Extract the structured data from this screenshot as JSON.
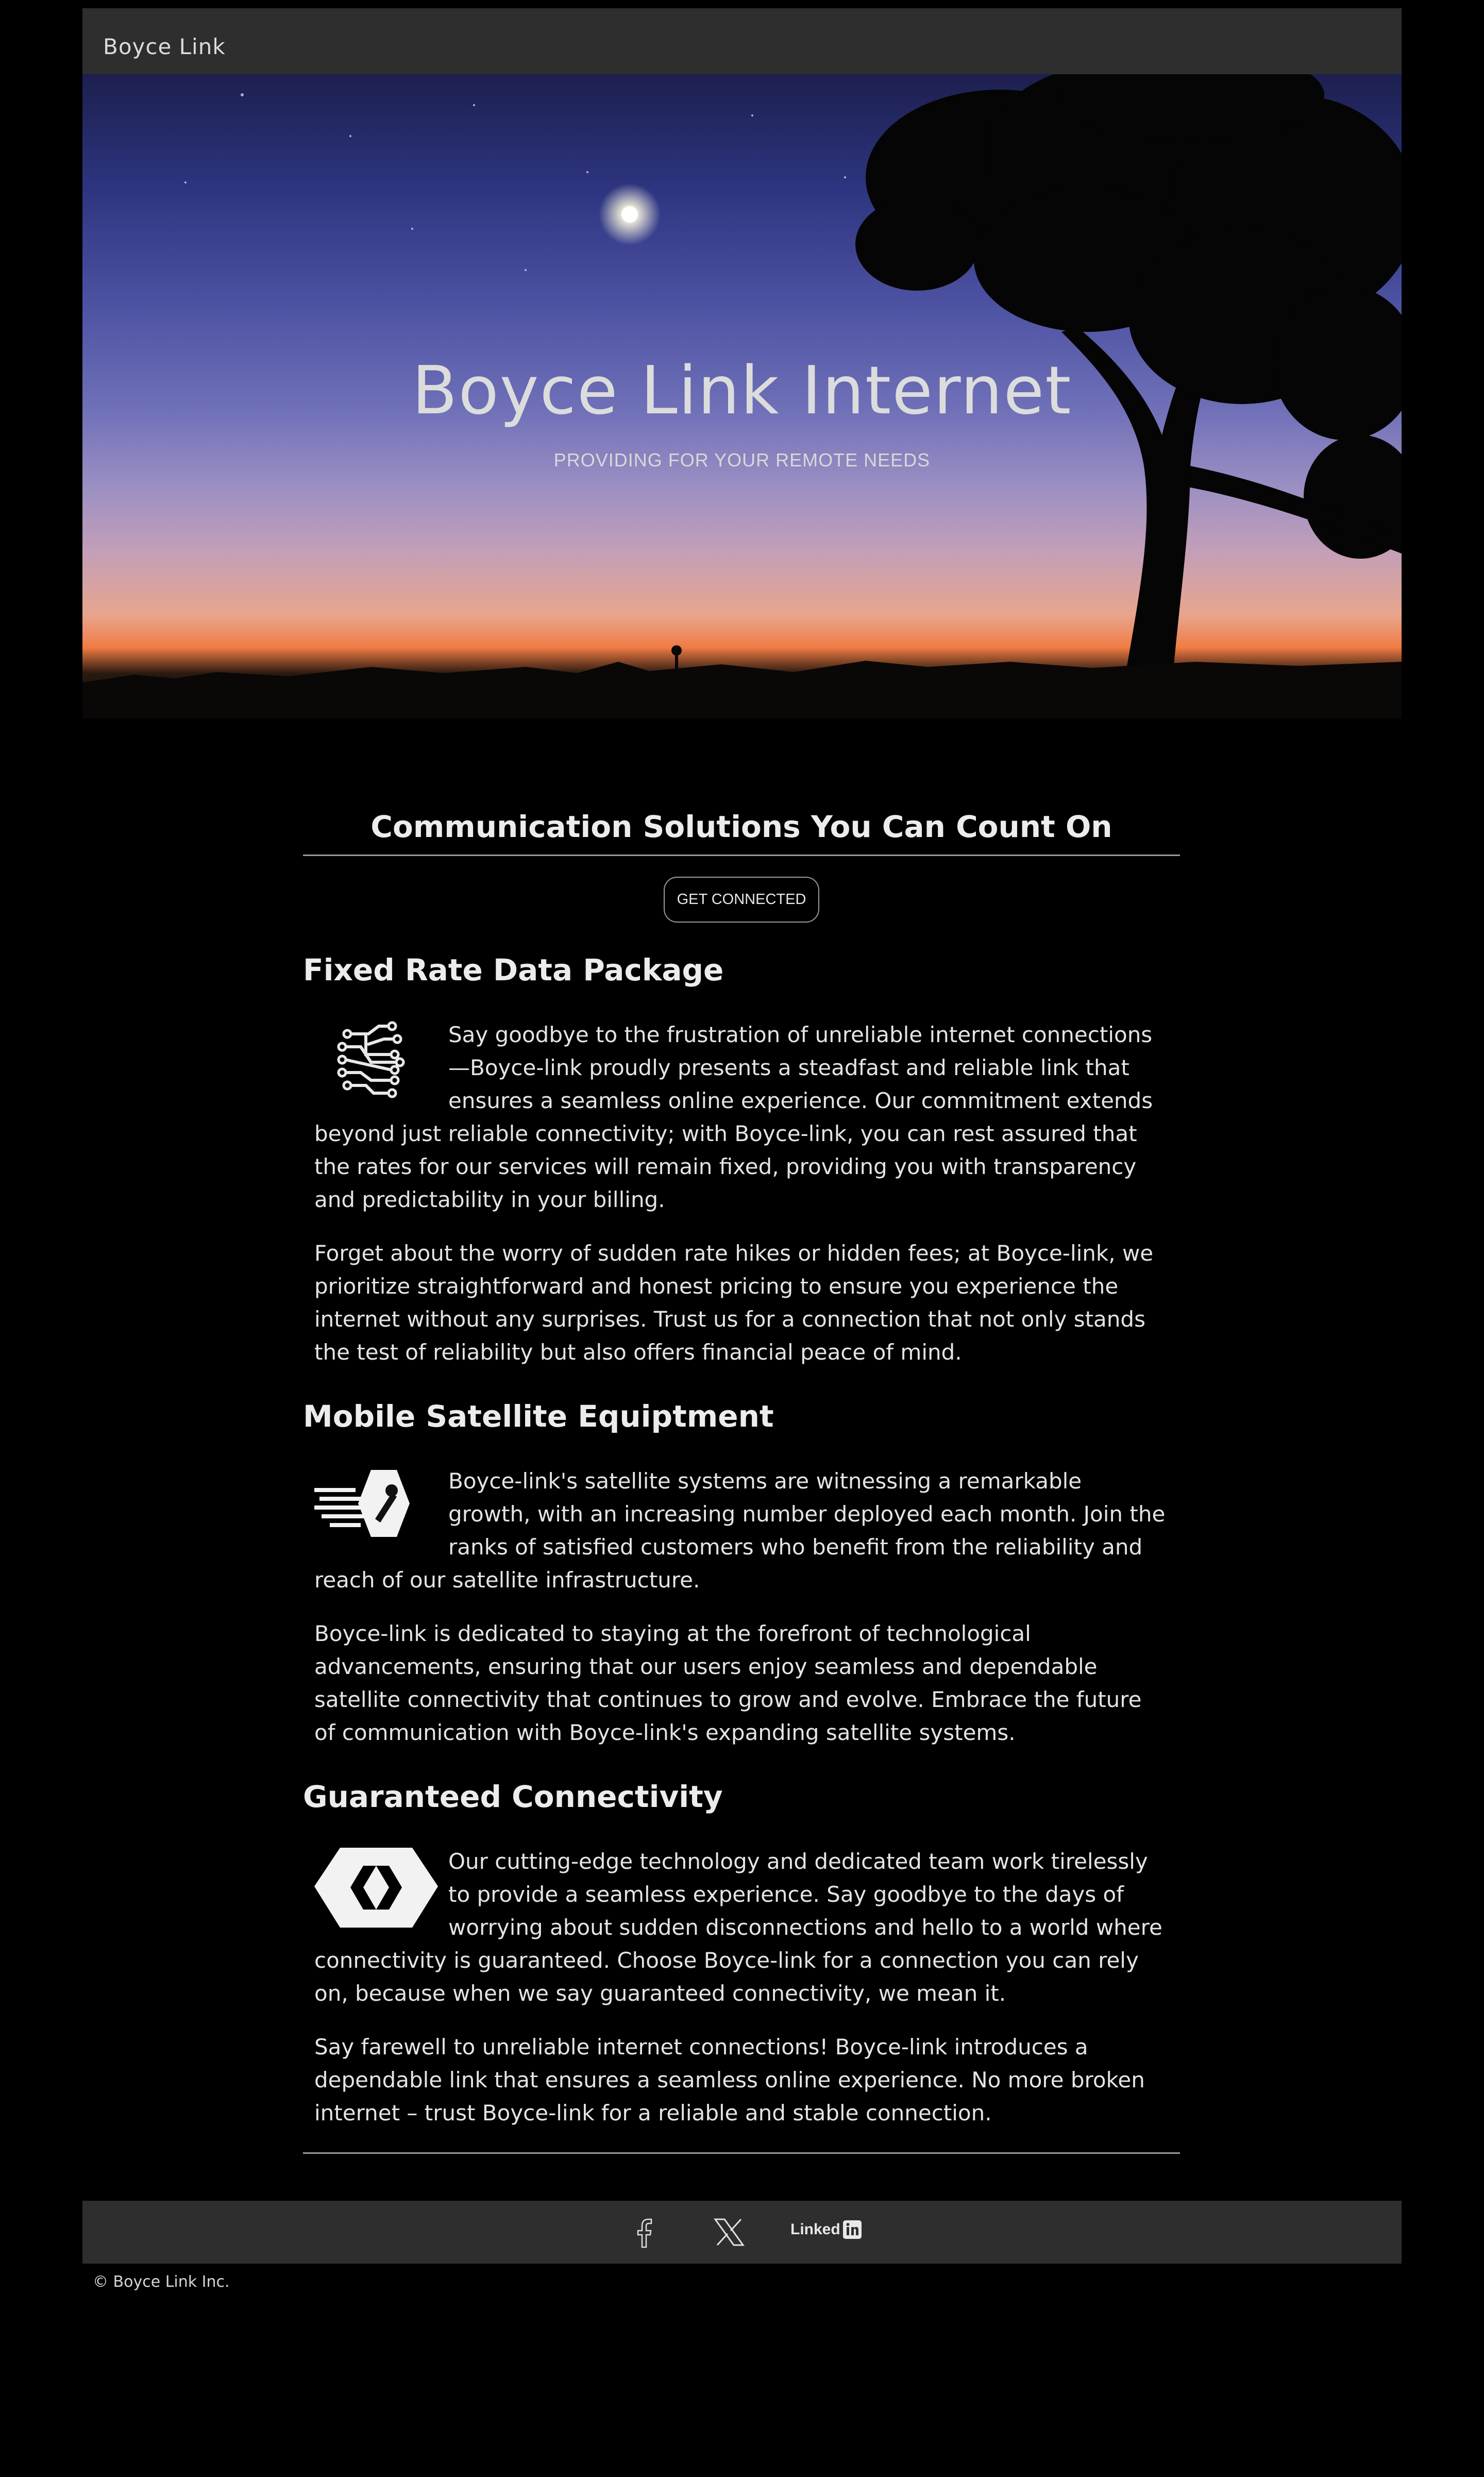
{
  "header": {
    "brand": "Boyce Link"
  },
  "hero": {
    "title": "Boyce Link Internet",
    "subtitle": "PROVIDING FOR YOUR REMOTE NEEDS"
  },
  "main": {
    "heading": "Communication Solutions You Can Count On",
    "cta_label": "GET CONNECTED",
    "sections": [
      {
        "title": "Fixed Rate Data Package",
        "icon": "circuit-icon",
        "paragraphs": [
          "Say goodbye to the frustration of unreliable internet connections—Boyce-link proudly presents a steadfast and reliable link that ensures a seamless online experience. Our commitment extends beyond just reliable connectivity; with Boyce-link, you can rest assured that the rates for our services will remain fixed, providing you with transparency and predictability in your billing.",
          "Forget about the worry of sudden rate hikes or hidden fees; at Boyce-link, we prioritize straightforward and honest pricing to ensure you experience the internet without any surprises. Trust us for a connection that not only stands the test of reliability but also offers financial peace of mind."
        ]
      },
      {
        "title": "Mobile Satellite Equiptment",
        "icon": "satellite-icon",
        "paragraphs": [
          "Boyce-link's satellite systems are witnessing a remarkable growth, with an increasing number deployed each month. Join the ranks of satisfied customers who benefit from the reliability and reach of our satellite infrastructure.",
          "Boyce-link is dedicated to staying at the forefront of technological advancements, ensuring that our users enjoy seamless and dependable satellite connectivity that continues to grow and evolve. Embrace the future of communication with Boyce-link's expanding satellite systems."
        ]
      },
      {
        "title": "Guaranteed Connectivity",
        "icon": "connection-icon",
        "paragraphs": [
          "Our cutting-edge technology and dedicated team work tirelessly to provide a seamless experience. Say goodbye to the days of worrying about sudden disconnections and hello to a world where connectivity is guaranteed. Choose Boyce-link for a connection you can rely on, because when we say guaranteed connectivity, we mean it.",
          "Say farewell to unreliable internet connections! Boyce-link introduces a dependable link that ensures a seamless online experience. No more broken internet – trust Boyce-link for a reliable and stable connection."
        ]
      }
    ]
  },
  "footer": {
    "social": [
      {
        "name": "facebook",
        "icon": "facebook-icon"
      },
      {
        "name": "x",
        "icon": "x-icon"
      },
      {
        "name": "linkedin",
        "icon": "linkedin-icon",
        "label": "Linked"
      }
    ],
    "copyright": "© Boyce Link Inc."
  },
  "colors": {
    "background": "#000000",
    "bar": "#2e2e2e",
    "text": "#e8e8e8",
    "rule": "#9a9a9a"
  }
}
